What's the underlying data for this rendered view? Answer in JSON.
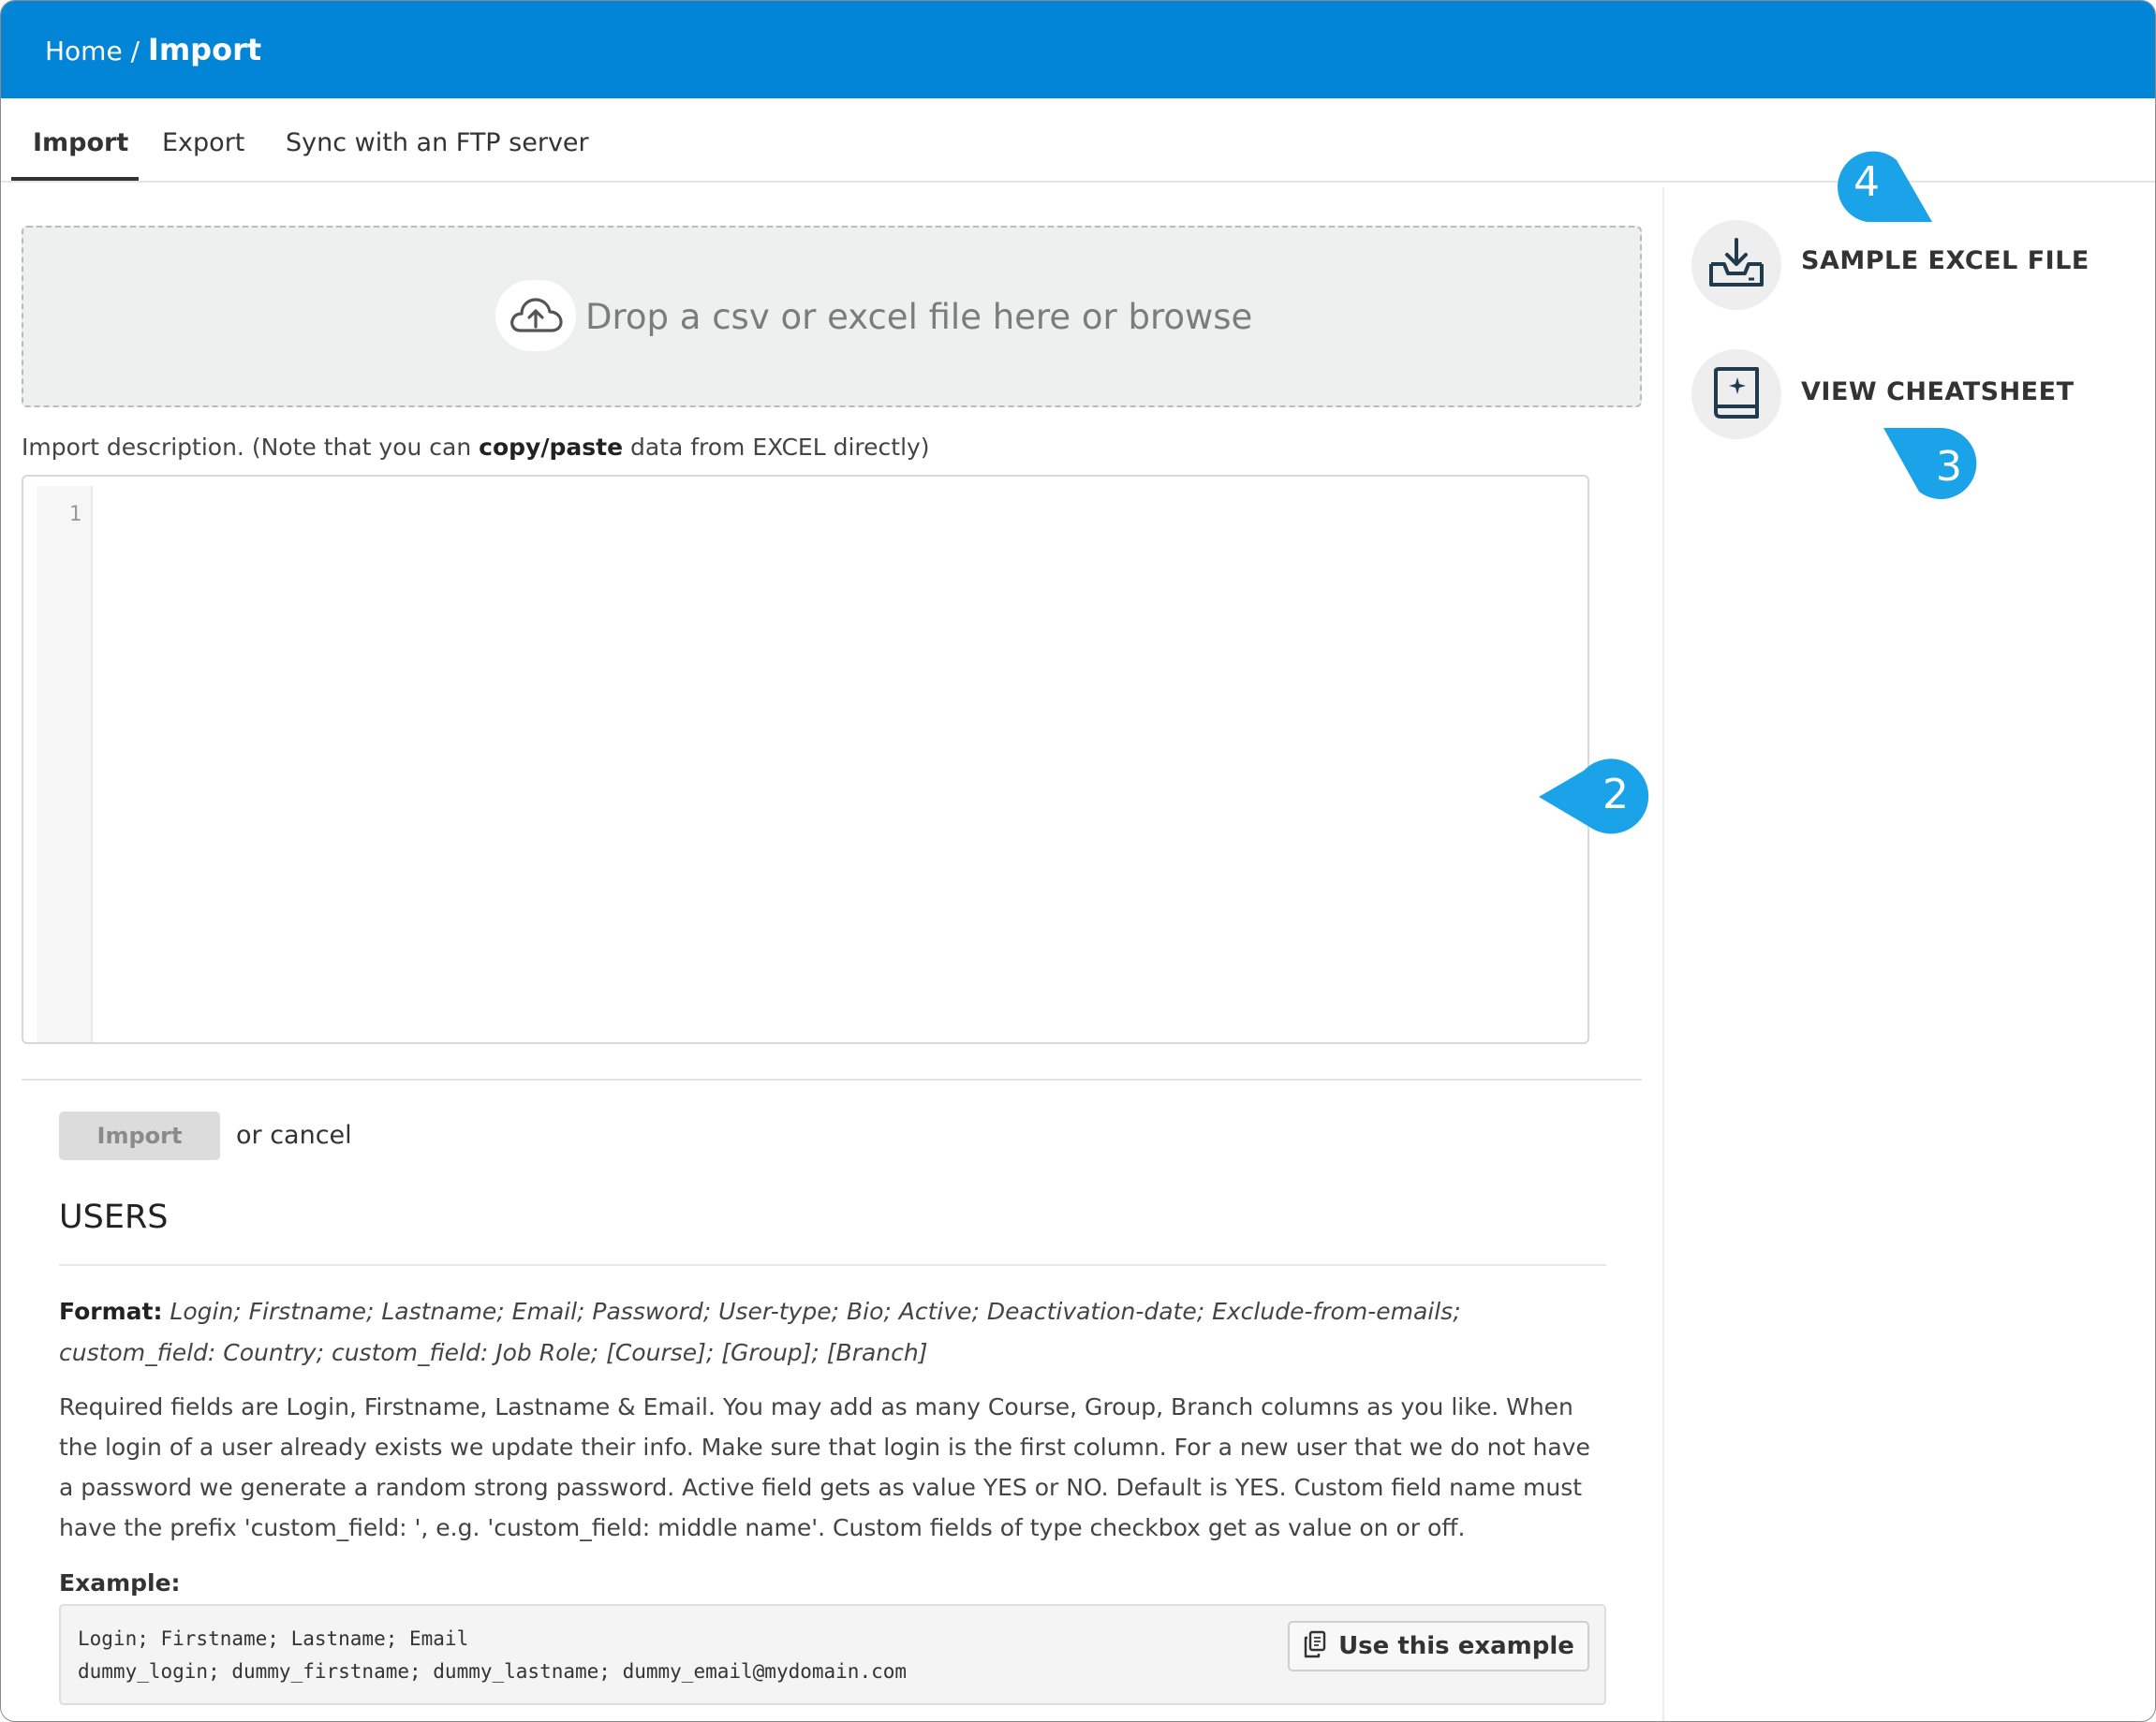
{
  "header": {
    "breadcrumb_home": "Home",
    "breadcrumb_separator": " / ",
    "breadcrumb_current": "Import",
    "background_color": "#0285d6"
  },
  "tabs": [
    {
      "label": "Import",
      "active": true
    },
    {
      "label": "Export",
      "active": false
    },
    {
      "label": "Sync with an FTP server",
      "active": false
    }
  ],
  "dropzone": {
    "icon": "cloud-upload-icon",
    "text": "Drop a csv or excel file here or browse"
  },
  "description": {
    "label_before": "Import description. (Note that you can ",
    "label_bold": "copy/paste",
    "label_after": " data from EXCEL directly)",
    "editor_line_number": "1",
    "editor_value": ""
  },
  "actions": {
    "import_label": "Import",
    "cancel_text": "or cancel"
  },
  "users": {
    "heading": "USERS",
    "format_label": "Format:",
    "format_value": " Login; Firstname; Lastname; Email; Password; User-type; Bio; Active; Deactivation-date; Exclude-from-emails; custom_field: Country; custom_field: Job Role; [Course]; [Group]; [Branch]",
    "required_text": "Required fields are Login, Firstname, Lastname & Email. You may add as many Course, Group, Branch columns as you like. When the login of a user already exists we update their info. Make sure that login is the first column. For a new user that we do not have a password we generate a random strong password. Active field gets as value YES or NO. Default is YES. Custom field name must have the prefix 'custom_field: ', e.g. 'custom_field: middle name'. Custom fields of type checkbox get as value on or off.",
    "example_label": "Example:",
    "example_code": "Login; Firstname; Lastname; Email\ndummy_login; dummy_firstname; dummy_lastname; dummy_email@mydomain.com",
    "use_example_label": "Use this example",
    "use_example_icon": "copy-icon"
  },
  "side_panel": {
    "sample_label": "SAMPLE EXCEL FILE",
    "sample_icon": "download-tray-icon",
    "cheatsheet_label": "VIEW CHEATSHEET",
    "cheatsheet_icon": "book-sparkle-icon"
  },
  "callouts": {
    "color": "#1aa3e8",
    "one": "2",
    "two": "3",
    "three": "4"
  }
}
